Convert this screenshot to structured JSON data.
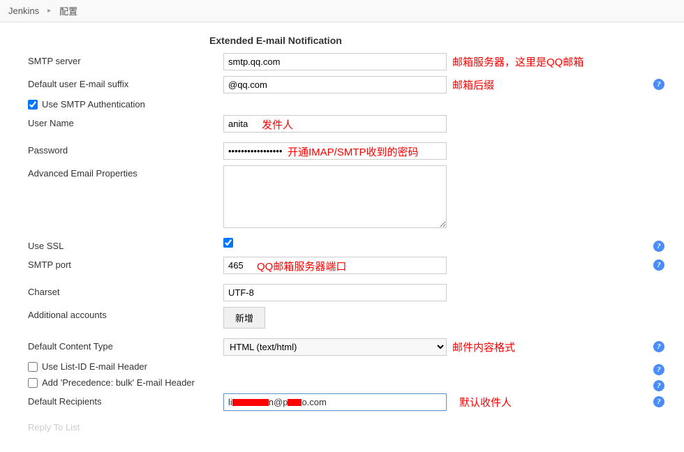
{
  "breadcrumb": {
    "root": "Jenkins",
    "page": "配置"
  },
  "section": {
    "title": "Extended E-mail Notification"
  },
  "fields": {
    "smtp_server": {
      "label": "SMTP server",
      "value": "smtp.qq.com"
    },
    "email_suffix": {
      "label": "Default user E-mail suffix",
      "value": "@qq.com"
    },
    "use_auth": {
      "label": "Use SMTP Authentication",
      "checked": true
    },
    "username": {
      "label": "User Name",
      "value": "anita"
    },
    "password": {
      "label": "Password",
      "value": "•••••••••••••••••"
    },
    "adv_props": {
      "label": "Advanced Email Properties",
      "value": ""
    },
    "use_ssl": {
      "label": "Use SSL",
      "checked": true
    },
    "smtp_port": {
      "label": "SMTP port",
      "value": "465"
    },
    "charset": {
      "label": "Charset",
      "value": "UTF-8"
    },
    "additional_accounts": {
      "label": "Additional accounts",
      "button": "新增"
    },
    "content_type": {
      "label": "Default Content Type",
      "value": "HTML (text/html)"
    },
    "list_id": {
      "label": "Use List-ID E-mail Header",
      "checked": false
    },
    "precedence": {
      "label": "Add 'Precedence: bulk' E-mail Header",
      "checked": false
    },
    "recipients": {
      "label": "Default Recipients",
      "prefix": "li",
      "suffix": "o.com",
      "mid": "n@p"
    },
    "reply_to": {
      "label": "Reply To List"
    }
  },
  "annotations": {
    "smtp_server": "邮箱服务器，这里是QQ邮箱",
    "email_suffix": "邮箱后缀",
    "username": "发件人",
    "password": "开通IMAP/SMTP收到的密码",
    "smtp_port": "QQ邮箱服务器端口",
    "content_type": "邮件内容格式",
    "recipients": "默认收件人"
  },
  "help_tooltip": "?"
}
